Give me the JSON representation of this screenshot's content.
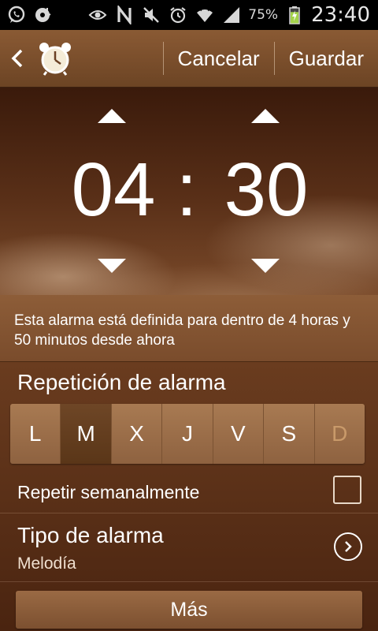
{
  "status_bar": {
    "icons_left": [
      "whatsapp-icon",
      "music-disc-icon"
    ],
    "icons_right": [
      "eye-icon",
      "nfc-icon",
      "mute-icon",
      "alarm-icon",
      "wifi-icon",
      "signal-icon"
    ],
    "battery_percent": "75%",
    "battery_level": 0.75,
    "time": "23:40"
  },
  "action_bar": {
    "icon": "alarm-clock-icon",
    "cancel_label": "Cancelar",
    "save_label": "Guardar"
  },
  "time_picker": {
    "hours": "04",
    "separator": ":",
    "minutes": "30"
  },
  "info": {
    "text": "Esta alarma está definida para dentro de 4 horas y 50 minutos desde ahora"
  },
  "repeat_section": {
    "title": "Repetición de alarma",
    "days": [
      {
        "label": "L",
        "selected": false
      },
      {
        "label": "M",
        "selected": true
      },
      {
        "label": "X",
        "selected": false
      },
      {
        "label": "J",
        "selected": false
      },
      {
        "label": "V",
        "selected": false
      },
      {
        "label": "S",
        "selected": false
      },
      {
        "label": "D",
        "selected": false
      }
    ],
    "weekly_label": "Repetir semanalmente",
    "weekly_checked": false
  },
  "alarm_type": {
    "title": "Tipo de alarma",
    "value": "Melodía"
  },
  "more_label": "Más",
  "colors": {
    "actionbar": "#7a4c2c",
    "selected_day": "#5a3618",
    "day": "#a87a52"
  }
}
